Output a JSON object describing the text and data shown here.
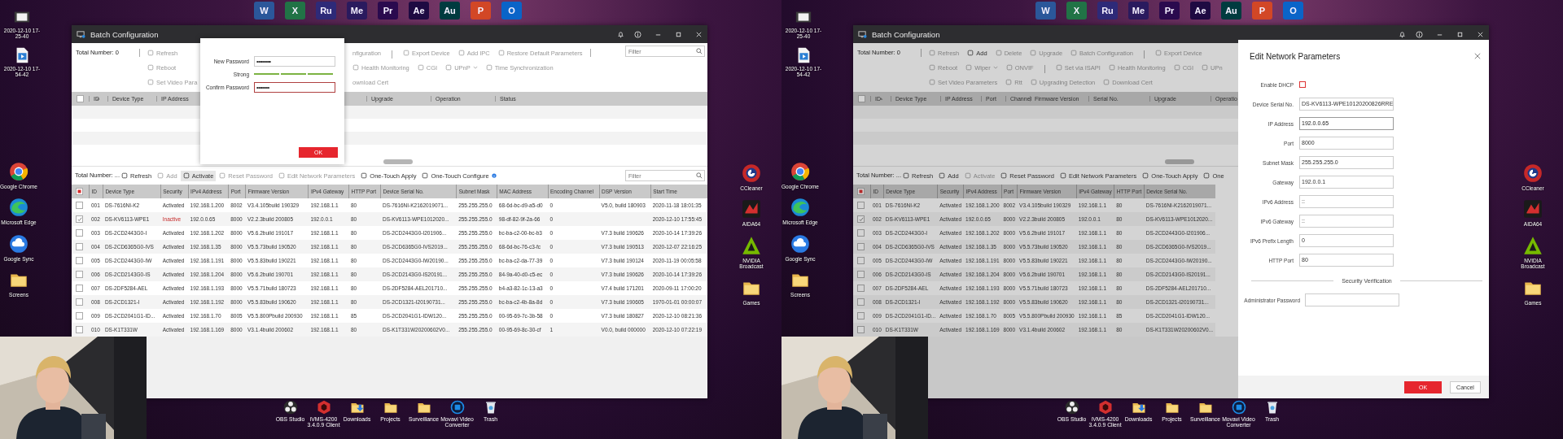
{
  "screens": [
    {
      "desktop": {
        "top_apps": [
          {
            "label": "W",
            "color": "#2b579a"
          },
          {
            "label": "X",
            "color": "#217346"
          },
          {
            "label": "Ru",
            "color": "#2e2a78"
          },
          {
            "label": "Me",
            "color": "#2a1a5e"
          },
          {
            "label": "Pr",
            "color": "#2a0a4e"
          },
          {
            "label": "Ae",
            "color": "#1e0a42"
          },
          {
            "label": "Au",
            "color": "#003b3f"
          },
          {
            "label": "P",
            "color": "#d24726"
          },
          {
            "label": "O",
            "color": "#0a64c8"
          }
        ],
        "files": [
          {
            "label": "2020-12-10 17-25-40",
            "kind": "video"
          },
          {
            "label": "2020-12-10 17-54-42",
            "kind": "media"
          }
        ],
        "shortcuts": [
          {
            "label": "Google Chrome",
            "kind": "chrome"
          },
          {
            "label": "Microsoft Edge",
            "kind": "edge"
          },
          {
            "label": "Google Sync",
            "kind": "cloud"
          },
          {
            "label": "Screens",
            "kind": "folder"
          }
        ],
        "right_icons": [
          {
            "label": "CCleaner",
            "kind": "ccleaner"
          },
          {
            "label": "AIDA64",
            "kind": "aida"
          },
          {
            "label": "NVIDIA Broadcast",
            "kind": "nvidia"
          },
          {
            "label": "Games",
            "kind": "folder"
          }
        ],
        "dock": [
          {
            "label": "OBS Studio",
            "kind": "obs"
          },
          {
            "label": "iVMS-4200 3.4.0.9 Client",
            "kind": "ivms"
          },
          {
            "label": "Downloads",
            "kind": "downloads"
          },
          {
            "label": "Projects",
            "kind": "folder"
          },
          {
            "label": "Surveillance",
            "kind": "folder"
          },
          {
            "label": "Movavi Video Converter",
            "kind": "movavi"
          },
          {
            "label": "Trash",
            "kind": "trash"
          }
        ]
      },
      "window": {
        "title": "Batch Configuration",
        "top_panel": {
          "total": "Total Number: 0",
          "filter_placeholder": "Filter",
          "select_all_checked": false,
          "toolbar_rows": [
            {
              "items": [
                {
                  "label": "Refresh",
                  "kind": "button",
                  "disabled": true
                }
              ],
              "items_right": [
                {
                  "label": "nfiguration",
                  "kind": "clipped",
                  "disabled": true
                },
                {
                  "kind": "separator"
                },
                {
                  "label": "Export Device",
                  "kind": "button",
                  "disabled": true
                },
                {
                  "label": "Add IPC",
                  "kind": "button",
                  "disabled": true
                },
                {
                  "label": "Restore Default Parameters",
                  "kind": "button",
                  "disabled": true
                }
              ]
            },
            {
              "items": [
                {
                  "label": "Reboot",
                  "kind": "button",
                  "disabled": true
                }
              ],
              "items_right": [
                {
                  "label": "Health Monitoring",
                  "kind": "button",
                  "disabled": true
                },
                {
                  "label": "CGI",
                  "kind": "button",
                  "disabled": true
                },
                {
                  "label": "UPnP",
                  "kind": "menu",
                  "disabled": true
                },
                {
                  "label": "Time Synchronization",
                  "kind": "button",
                  "disabled": true
                }
              ]
            },
            {
              "items": [
                {
                  "label": "Set Video Para",
                  "kind": "button",
                  "disabled": true
                }
              ],
              "items_right": [
                {
                  "label": "ownload Cert",
                  "kind": "clipped",
                  "disabled": true
                }
              ]
            }
          ],
          "columns": [
            "ID",
            "Device Type",
            "IP Address"
          ],
          "columns_right": [
            "Upgrade",
            "Operation",
            "Status"
          ]
        },
        "bottom_panel": {
          "total": "Total Number: ...",
          "filter_placeholder": "Filter",
          "select_all_partial": true,
          "toolbar": [
            {
              "label": "Refresh",
              "kind": "button",
              "disabled": false,
              "highlighted": false
            },
            {
              "label": "Add",
              "kind": "button",
              "disabled": true,
              "highlighted": false
            },
            {
              "label": "Activate",
              "kind": "button",
              "disabled": false,
              "highlighted": true
            },
            {
              "label": "Reset Password",
              "kind": "button",
              "disabled": true,
              "highlighted": false
            },
            {
              "label": "Edit Network Parameters",
              "kind": "button",
              "disabled": true,
              "highlighted": false
            },
            {
              "label": "One-Touch Apply",
              "kind": "button",
              "disabled": false,
              "highlighted": false
            },
            {
              "label": "One-Touch Configure",
              "kind": "help",
              "disabled": false,
              "highlighted": false
            }
          ],
          "columns": [
            "ID",
            "Device Type",
            "Security",
            "IPv4 Address",
            "Port",
            "Firmware Version",
            "IPv4 Gateway",
            "HTTP Port",
            "Device Serial No.",
            "Subnet Mask",
            "MAC Address",
            "Encoding Channel",
            "DSP Version",
            "Start Time"
          ],
          "rows": [
            {
              "checked": false,
              "activated": true,
              "cells": [
                "001",
                "DS-7616NI-K2",
                "Activated",
                "192.168.1.200",
                "8002",
                "V3.4.105build 190329",
                "192.168.1.1",
                "80",
                "DS-7616NI-K2162019071...",
                "255.255.255.0",
                "68-6d-bc-d9-a5-d0",
                "0",
                "V5.0, build 180903",
                "2020-11-18 18:01:35"
              ]
            },
            {
              "checked": true,
              "activated": false,
              "cells": [
                "002",
                "DS-KV6113-WPE1",
                "Inactive",
                "192.0.0.65",
                "8000",
                "V2.2.3build 200805",
                "192.0.0.1",
                "80",
                "DS-KV6113-WPE1012020...",
                "255.255.255.0",
                "98-df-82-9f-2a-66",
                "0",
                "",
                "2020-12-10 17:55:45"
              ]
            },
            {
              "checked": false,
              "activated": true,
              "cells": [
                "003",
                "DS-2CD2443G0-I",
                "Activated",
                "192.168.1.202",
                "8000",
                "V5.6.2build 191017",
                "192.168.1.1",
                "80",
                "DS-2CD2443G0-I201906...",
                "255.255.255.0",
                "bc-ba-c2-00-bc-b3",
                "0",
                "V7.3 build 190626",
                "2020-10-14 17:39:26"
              ]
            },
            {
              "checked": false,
              "activated": true,
              "cells": [
                "004",
                "DS-2CD6365G0-IVS",
                "Activated",
                "192.168.1.35",
                "8000",
                "V5.5.73build 190520",
                "192.168.1.1",
                "80",
                "DS-2CD6365G0-IVS2019...",
                "255.255.255.0",
                "68-6d-bc-76-c3-fc",
                "0",
                "V7.3 build 190513",
                "2020-12-07 22:16:25"
              ]
            },
            {
              "checked": false,
              "activated": true,
              "cells": [
                "005",
                "DS-2CD2443G0-IW",
                "Activated",
                "192.168.1.191",
                "8000",
                "V5.5.83build 190221",
                "192.168.1.1",
                "80",
                "DS-2CD2443G0-IW20190...",
                "255.255.255.0",
                "bc-ba-c2-da-77-39",
                "0",
                "V7.3 build 190124",
                "2020-11-19 00:05:58"
              ]
            },
            {
              "checked": false,
              "activated": true,
              "cells": [
                "006",
                "DS-2CD2143G0-IS",
                "Activated",
                "192.168.1.204",
                "8000",
                "V5.6.2build 190701",
                "192.168.1.1",
                "80",
                "DS-2CD2143G0-IS20191...",
                "255.255.255.0",
                "84-9a-40-d0-c5-ec",
                "0",
                "V7.3 build 190626",
                "2020-10-14 17:39:26"
              ]
            },
            {
              "checked": false,
              "activated": true,
              "cells": [
                "007",
                "DS-2DF5284-AEL",
                "Activated",
                "192.168.1.193",
                "8000",
                "V5.5.71build 180723",
                "192.168.1.1",
                "80",
                "DS-2DF5284-AEL201710...",
                "255.255.255.0",
                "b4-a3-82-1c-13-a3",
                "0",
                "V7.4 build 171201",
                "2020-09-11 17:00:20"
              ]
            },
            {
              "checked": false,
              "activated": true,
              "cells": [
                "008",
                "DS-2CD1321-I",
                "Activated",
                "192.168.1.192",
                "8000",
                "V5.5.83build 190620",
                "192.168.1.1",
                "80",
                "DS-2CD1321-I20190731...",
                "255.255.255.0",
                "bc-ba-c2-4b-8a-8d",
                "0",
                "V7.3 build 190605",
                "1970-01-01 00:00:07"
              ]
            },
            {
              "checked": false,
              "activated": true,
              "cells": [
                "009",
                "DS-2CD2041G1-ID...",
                "Activated",
                "192.168.1.70",
                "8005",
                "V5.5.800Pbuild 200930",
                "192.168.1.1",
                "85",
                "DS-2CD2041G1-IDW120...",
                "255.255.255.0",
                "00-95-69-7c-3b-58",
                "0",
                "V7.3 build 180827",
                "2020-12-10 08:21:36"
              ]
            },
            {
              "checked": false,
              "activated": true,
              "cells": [
                "010",
                "DS-K1T331W",
                "Activated",
                "192.168.1.169",
                "8000",
                "V3.1.4build 200602",
                "192.168.1.1",
                "80",
                "DS-K1T331W20200602V0...",
                "255.255.255.0",
                "00-95-69-8c-30-cf",
                "1",
                "V0.0, build 000000",
                "2020-12-10 07:22:19"
              ]
            }
          ]
        }
      },
      "dialog": {
        "kind": "password",
        "fields": [
          {
            "kind": "field",
            "label": "New Password",
            "value": "•••••••••",
            "focused": false
          },
          {
            "kind": "meter",
            "label": "Strong",
            "level": 1
          },
          {
            "kind": "field",
            "label": "Confirm Password",
            "value": "••••••••",
            "focused": true
          }
        ],
        "ok": "OK"
      }
    },
    {
      "desktop": {
        "top_apps": [
          {
            "label": "W",
            "color": "#2b579a"
          },
          {
            "label": "X",
            "color": "#217346"
          },
          {
            "label": "Ru",
            "color": "#2e2a78"
          },
          {
            "label": "Me",
            "color": "#2a1a5e"
          },
          {
            "label": "Pr",
            "color": "#2a0a4e"
          },
          {
            "label": "Ae",
            "color": "#1e0a42"
          },
          {
            "label": "Au",
            "color": "#003b3f"
          },
          {
            "label": "P",
            "color": "#d24726"
          },
          {
            "label": "O",
            "color": "#0a64c8"
          }
        ],
        "files": [
          {
            "label": "2020-12-10 17-25-40",
            "kind": "video"
          },
          {
            "label": "2020-12-10 17-54-42",
            "kind": "media"
          }
        ],
        "shortcuts": [
          {
            "label": "Google Chrome",
            "kind": "chrome"
          },
          {
            "label": "Microsoft Edge",
            "kind": "edge"
          },
          {
            "label": "Google Sync",
            "kind": "cloud"
          },
          {
            "label": "Screens",
            "kind": "folder"
          }
        ],
        "right_icons": [
          {
            "label": "CCleaner",
            "kind": "ccleaner"
          },
          {
            "label": "AIDA64",
            "kind": "aida"
          },
          {
            "label": "NVIDIA Broadcast",
            "kind": "nvidia"
          },
          {
            "label": "Games",
            "kind": "folder"
          }
        ],
        "dock": [
          {
            "label": "OBS Studio",
            "kind": "obs"
          },
          {
            "label": "iVMS-4200 3.4.0.9 Client",
            "kind": "ivms"
          },
          {
            "label": "Downloads",
            "kind": "downloads"
          },
          {
            "label": "Projects",
            "kind": "folder"
          },
          {
            "label": "Surveillance",
            "kind": "folder"
          },
          {
            "label": "Movavi Video Converter",
            "kind": "movavi"
          },
          {
            "label": "Trash",
            "kind": "trash"
          }
        ]
      },
      "window": {
        "title": "Batch Configuration",
        "top_panel": {
          "total": "Total Number: 0",
          "select_all_checked": false,
          "toolbar_rows": [
            {
              "items": [
                {
                  "label": "Refresh",
                  "kind": "button",
                  "disabled": true
                },
                {
                  "label": "Add",
                  "kind": "button",
                  "disabled": false
                },
                {
                  "label": "Delete",
                  "kind": "button",
                  "disabled": true
                },
                {
                  "label": "Upgrade",
                  "kind": "button",
                  "disabled": true
                },
                {
                  "label": "Batch Configuration",
                  "kind": "button",
                  "disabled": true
                },
                {
                  "kind": "separator"
                },
                {
                  "label": "Export Device",
                  "kind": "button",
                  "disabled": true
                }
              ]
            },
            {
              "items": [
                {
                  "label": "Reboot",
                  "kind": "button",
                  "disabled": true
                },
                {
                  "label": "Wiper",
                  "kind": "menu",
                  "disabled": true
                },
                {
                  "label": "ONVIF",
                  "kind": "button",
                  "disabled": true
                },
                {
                  "kind": "separator"
                },
                {
                  "label": "Set via ISAPI",
                  "kind": "button",
                  "disabled": true
                },
                {
                  "label": "Health Monitoring",
                  "kind": "button",
                  "disabled": true
                },
                {
                  "label": "CGI",
                  "kind": "button",
                  "disabled": true
                },
                {
                  "label": "UPn",
                  "kind": "button",
                  "disabled": true
                }
              ]
            },
            {
              "items": [
                {
                  "label": "Set Video Parameters",
                  "kind": "button",
                  "disabled": true
                },
                {
                  "label": "Rtt",
                  "kind": "button",
                  "disabled": true
                },
                {
                  "label": "Upgrading Detection",
                  "kind": "button",
                  "disabled": true
                },
                {
                  "label": "Download Cert",
                  "kind": "button",
                  "disabled": true
                }
              ]
            }
          ],
          "columns": [
            "ID",
            "Device Type",
            "IP Address",
            "Port",
            "Channel",
            "Firmware Version",
            "Serial No.",
            "Upgrade",
            "Operatio"
          ]
        },
        "bottom_panel": {
          "total": "Total Number: ...",
          "select_all_partial": true,
          "toolbar": [
            {
              "label": "Refresh",
              "kind": "button",
              "disabled": false,
              "highlighted": false
            },
            {
              "label": "Add",
              "kind": "button",
              "disabled": false,
              "highlighted": false
            },
            {
              "label": "Activate",
              "kind": "button",
              "disabled": true,
              "highlighted": false
            },
            {
              "label": "Reset Password",
              "kind": "button",
              "disabled": false,
              "highlighted": false
            },
            {
              "label": "Edit Network Parameters",
              "kind": "button",
              "disabled": false,
              "highlighted": false
            },
            {
              "label": "One-Touch Apply",
              "kind": "button",
              "disabled": false,
              "highlighted": false
            },
            {
              "label": "One",
              "kind": "button",
              "disabled": false,
              "highlighted": false
            }
          ],
          "columns": [
            "ID",
            "Device Type",
            "Security",
            "IPv4 Address",
            "Port",
            "Firmware Version",
            "IPv4 Gateway",
            "HTTP Port",
            "Device Serial No."
          ],
          "rows": [
            {
              "checked": false,
              "activated": true,
              "cells": [
                "001",
                "DS-7616NI-K2",
                "Activated",
                "192.168.1.200",
                "8002",
                "V3.4.105build 190329",
                "192.168.1.1",
                "80",
                "DS-7616NI-K2162019071..."
              ]
            },
            {
              "checked": true,
              "activated": true,
              "cells": [
                "002",
                "DS-KV6113-WPE1",
                "Activated",
                "192.0.0.65",
                "8000",
                "V2.2.3build 200805",
                "192.0.0.1",
                "80",
                "DS-KV6113-WPE1012020..."
              ]
            },
            {
              "checked": false,
              "activated": true,
              "cells": [
                "003",
                "DS-2CD2443G0-I",
                "Activated",
                "192.168.1.202",
                "8000",
                "V5.6.2build 191017",
                "192.168.1.1",
                "80",
                "DS-2CD2443G0-I201906..."
              ]
            },
            {
              "checked": false,
              "activated": true,
              "cells": [
                "004",
                "DS-2CD6365G0-IVS",
                "Activated",
                "192.168.1.35",
                "8000",
                "V5.5.73build 190520",
                "192.168.1.1",
                "80",
                "DS-2CD6365G0-IVS2019..."
              ]
            },
            {
              "checked": false,
              "activated": true,
              "cells": [
                "005",
                "DS-2CD2443G0-IW",
                "Activated",
                "192.168.1.191",
                "8000",
                "V5.5.83build 190221",
                "192.168.1.1",
                "80",
                "DS-2CD2443G0-IW20190..."
              ]
            },
            {
              "checked": false,
              "activated": true,
              "cells": [
                "006",
                "DS-2CD2143G0-IS",
                "Activated",
                "192.168.1.204",
                "8000",
                "V5.6.2build 190701",
                "192.168.1.1",
                "80",
                "DS-2CD2143G0-IS20191..."
              ]
            },
            {
              "checked": false,
              "activated": true,
              "cells": [
                "007",
                "DS-2DF5284-AEL",
                "Activated",
                "192.168.1.193",
                "8000",
                "V5.5.71build 180723",
                "192.168.1.1",
                "80",
                "DS-2DF5284-AEL201710..."
              ]
            },
            {
              "checked": false,
              "activated": true,
              "cells": [
                "008",
                "DS-2CD1321-I",
                "Activated",
                "192.168.1.192",
                "8000",
                "V5.5.83build 190620",
                "192.168.1.1",
                "80",
                "DS-2CD1321-I20190731..."
              ]
            },
            {
              "checked": false,
              "activated": true,
              "cells": [
                "009",
                "DS-2CD2041G1-ID...",
                "Activated",
                "192.168.1.70",
                "8005",
                "V5.5.800Pbuild 200930",
                "192.168.1.1",
                "85",
                "DS-2CD2041G1-IDW120..."
              ]
            },
            {
              "checked": false,
              "activated": true,
              "cells": [
                "010",
                "DS-K1T331W",
                "Activated",
                "192.168.1.169",
                "8000",
                "V3.1.4build 200602",
                "192.168.1.1",
                "80",
                "DS-K1T331W20200602V0..."
              ]
            }
          ]
        }
      },
      "dialog": {
        "kind": "drawer",
        "title": "Edit Network Parameters",
        "fields": [
          {
            "kind": "checkbox",
            "label": "Enable DHCP",
            "checked": false
          },
          {
            "kind": "field",
            "label": "Device Serial No.",
            "value": "DS-KV6113-WPE10120200826RRE",
            "focused": false
          },
          {
            "kind": "field",
            "label": "IP Address",
            "value": "192.0.0.65",
            "focused": true
          },
          {
            "kind": "field",
            "label": "Port",
            "value": "8000",
            "focused": false
          },
          {
            "kind": "field",
            "label": "Subnet Mask",
            "value": "255.255.255.0",
            "focused": false
          },
          {
            "kind": "field",
            "label": "Gateway",
            "value": "192.0.0.1",
            "focused": false
          },
          {
            "kind": "field",
            "label": "IPv6 Address",
            "value": "::",
            "focused": false
          },
          {
            "kind": "field",
            "label": "IPv6 Gateway",
            "value": "::",
            "focused": false
          },
          {
            "kind": "field",
            "label": "IPv6 Prefix Length",
            "value": "0",
            "focused": false
          },
          {
            "kind": "field",
            "label": "HTTP Port",
            "value": "80",
            "focused": false
          }
        ],
        "section": "Security Verification",
        "password_label": "Administrator Password",
        "ok": "OK",
        "cancel": "Cancel"
      }
    }
  ]
}
